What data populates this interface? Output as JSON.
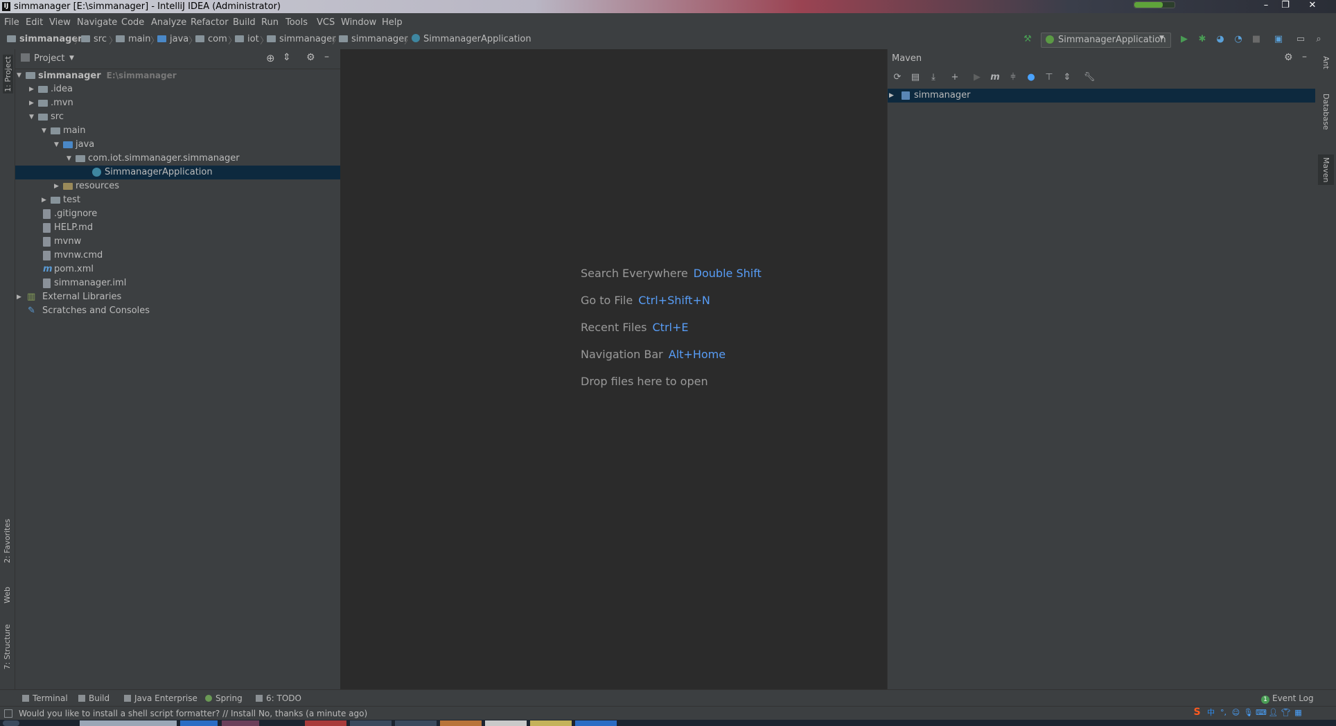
{
  "window": {
    "title": "simmanager [E:\\simmanager] - IntelliJ IDEA (Administrator)",
    "app_icon": "IJ"
  },
  "menu": [
    "File",
    "Edit",
    "View",
    "Navigate",
    "Code",
    "Analyze",
    "Refactor",
    "Build",
    "Run",
    "Tools",
    "VCS",
    "Window",
    "Help"
  ],
  "breadcrumbs": [
    "simmanager",
    "src",
    "main",
    "java",
    "com",
    "iot",
    "simmanager",
    "simmanager",
    "SimmanagerApplication"
  ],
  "run_config": {
    "label": "SimmanagerApplication"
  },
  "left_tabs": {
    "project": "1: Project",
    "favorites": "2: Favorites",
    "web": "Web",
    "structure": "7: Structure"
  },
  "right_tabs": {
    "ant": "Ant",
    "database": "Database",
    "maven": "Maven"
  },
  "project_panel": {
    "title": "Project",
    "tree": [
      {
        "label": "simmanager",
        "hint": "E:\\simmanager",
        "bold": true
      },
      {
        "label": ".idea"
      },
      {
        "label": ".mvn"
      },
      {
        "label": "src"
      },
      {
        "label": "main"
      },
      {
        "label": "java"
      },
      {
        "label": "com.iot.simmanager.simmanager"
      },
      {
        "label": "SimmanagerApplication"
      },
      {
        "label": "resources"
      },
      {
        "label": "test"
      },
      {
        "label": ".gitignore"
      },
      {
        "label": "HELP.md"
      },
      {
        "label": "mvnw"
      },
      {
        "label": "mvnw.cmd"
      },
      {
        "label": "pom.xml"
      },
      {
        "label": "simmanager.iml"
      },
      {
        "label": "External Libraries"
      },
      {
        "label": "Scratches and Consoles"
      }
    ]
  },
  "editor_hints": [
    {
      "text": "Search Everywhere",
      "key": "Double Shift"
    },
    {
      "text": "Go to File",
      "key": "Ctrl+Shift+N"
    },
    {
      "text": "Recent Files",
      "key": "Ctrl+E"
    },
    {
      "text": "Navigation Bar",
      "key": "Alt+Home"
    },
    {
      "text": "Drop files here to open",
      "key": ""
    }
  ],
  "maven": {
    "title": "Maven",
    "root": "simmanager"
  },
  "bottom_tabs": [
    "Terminal",
    "Build",
    "Java Enterprise",
    "Spring",
    "6: TODO"
  ],
  "event_log": {
    "count": "1",
    "label": "Event Log"
  },
  "status_message": "Would you like to install a shell script formatter? // Install   No, thanks (a minute ago)",
  "ime": {
    "chinese": "中"
  },
  "colors": {
    "accent_blue": "#589df6",
    "selection": "#0d293e",
    "panel": "#3c3f41",
    "editor": "#2b2b2b",
    "run_green": "#499c54"
  }
}
